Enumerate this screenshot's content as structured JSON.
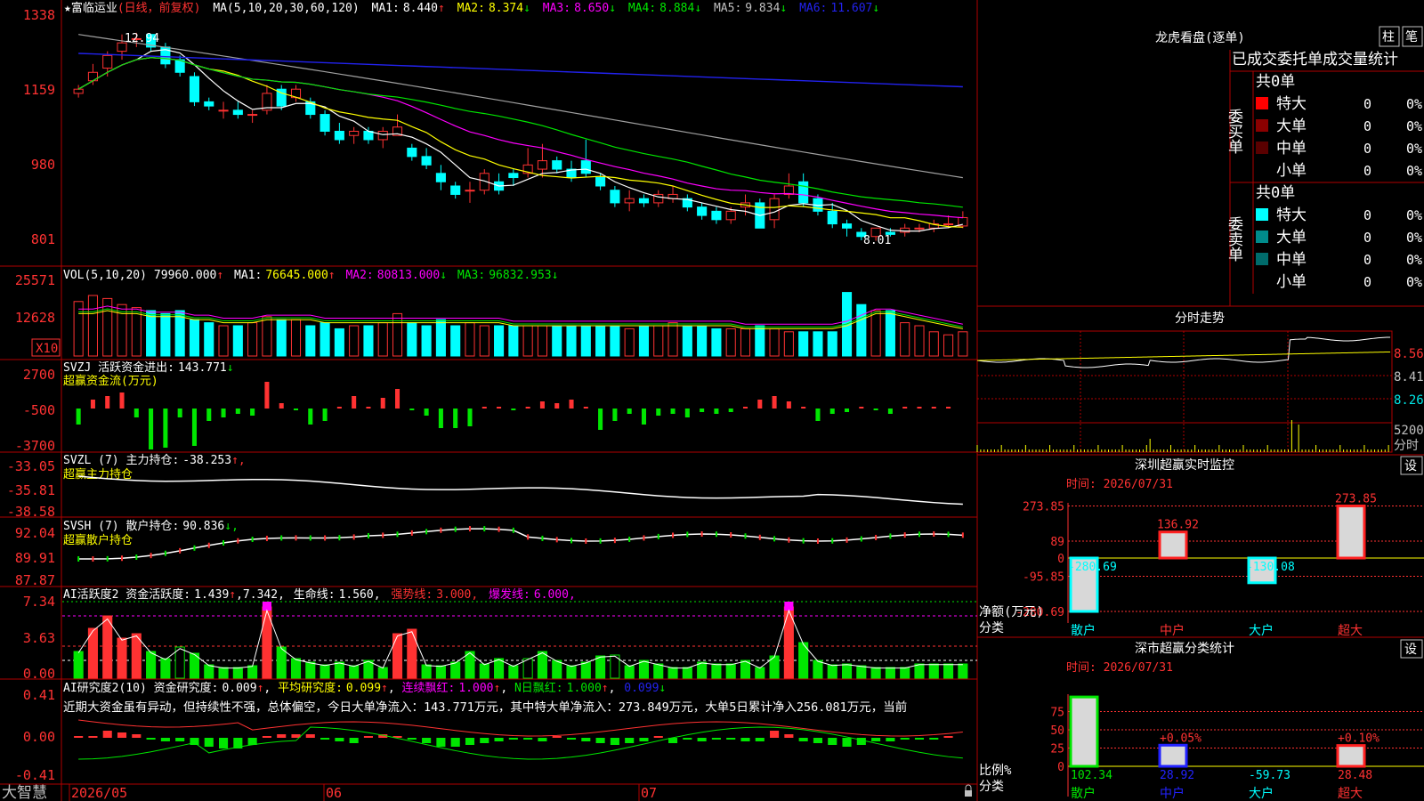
{
  "colors": {
    "background": "#000000",
    "frame": "#b00000",
    "up": "#ff3232",
    "down": "#00ffff",
    "ma1": "#ffffff",
    "ma2": "#ffff00",
    "ma3": "#ff00ff",
    "ma4": "#00e600",
    "ma5": "#a0a0a0",
    "ma6": "#2222ee",
    "green_bar": "#00e600",
    "axis_text": "#ff3232"
  },
  "main_panel": {
    "star": "★",
    "stock_name": "富临运业",
    "period_note": "(日线，前复权)",
    "ma_prefix": "MA(5,10,20,30,60,120)",
    "ma": [
      {
        "label": "MA1:",
        "value": "8.440",
        "arrow": "↑"
      },
      {
        "label": "MA2:",
        "value": "8.374",
        "arrow": "↓"
      },
      {
        "label": "MA3:",
        "value": "8.650",
        "arrow": "↓"
      },
      {
        "label": "MA4:",
        "value": "8.884",
        "arrow": "↓"
      },
      {
        "label": "MA5:",
        "value": "9.834",
        "arrow": "↓"
      },
      {
        "label": "MA6:",
        "value": "11.607",
        "arrow": "↓"
      }
    ],
    "y_ticks": [
      "1338",
      "1159",
      "980",
      "801"
    ],
    "high_label": "12.94",
    "low_label": "8.01"
  },
  "vol_panel": {
    "prefix": "VOL(5,10,20)",
    "value": "79960.000",
    "arrow": "↑",
    "ma": [
      {
        "label": "MA1:",
        "value": "76645.000",
        "arrow": "↑"
      },
      {
        "label": "MA2:",
        "value": "80813.000",
        "arrow": "↓"
      },
      {
        "label": "MA3:",
        "value": "96832.953",
        "arrow": "↓"
      }
    ],
    "y_ticks": [
      "25571",
      "12628"
    ],
    "unit": "X10"
  },
  "svzj_panel": {
    "title": "SVZJ  活跃资金进出:",
    "value": "143.771",
    "arrow": "↓",
    "subtitle": "超赢资金流(万元)",
    "y_ticks": [
      "2700",
      "-500",
      "-3700"
    ]
  },
  "svzl_panel": {
    "title": "SVZL (7) 主力持仓:",
    "value": "-38.253",
    "arrow": "↑,",
    "subtitle": "超赢主力持仓",
    "y_ticks": [
      "-33.05",
      "-35.81",
      "-38.58"
    ]
  },
  "svsh_panel": {
    "title": "SVSH (7) 散户持仓:",
    "value": "90.836",
    "arrow": "↓,",
    "subtitle": "超赢散户持仓",
    "y_ticks": [
      "92.04",
      "89.91",
      "87.87"
    ]
  },
  "ai_active_panel": {
    "title": "AI活跃度2 资金活跃度:",
    "v1": "1.439",
    "a1": "↑",
    "v2": ",7.342,",
    "life_label": "生命线:",
    "life_value": "1.560,",
    "strong_label": "强势线:",
    "strong_value": "3.000,",
    "burst_label": "爆发线:",
    "burst_value": "6.000,",
    "y_ticks": [
      "7.34",
      "3.63",
      "0.00"
    ]
  },
  "ai_research_panel": {
    "title": "AI研究度2(10) 资金研究度:",
    "v1": "0.009",
    "a1": "↑",
    "avg_label": "平均研究度:",
    "avg_value": "0.099",
    "avg_arrow": "↑",
    "red_label": "连续飘红:",
    "red_value": "1.000",
    "red_arrow": "↑",
    "nday_label": "N日飘红:",
    "nday_value": "1.000",
    "nday_arrow": "↑",
    "last_value": "0.099",
    "last_arrow": "↓",
    "commentary": "近期大资金虽有异动，但持续性不强，总体偏空，今日大单净流入：143.771万元，其中特大单净流入：273.849万元，大单5日累计净入256.081万元，当前",
    "y_ticks": [
      "0.41",
      "0.00",
      "-0.41"
    ]
  },
  "bottom_bar": {
    "brand": "大智慧",
    "dates": [
      "2026/05",
      "06",
      "07"
    ]
  },
  "right_panel": {
    "lhkp_title": "龙虎看盘(逐单)",
    "btn_zhu": "柱",
    "btn_bi": "笔",
    "stats_header": "已成交委托单成交量统计",
    "buy_label": "委买单",
    "sell_label": "委卖单",
    "buy_total": "共0单",
    "sell_total": "共0单",
    "buy_rows": [
      {
        "name": "特大",
        "count": "0",
        "pct": "0%",
        "color": "#ff0000"
      },
      {
        "name": "大单",
        "count": "0",
        "pct": "0%",
        "color": "#8b0000"
      },
      {
        "name": "中单",
        "count": "0",
        "pct": "0%",
        "color": "#5a0000"
      },
      {
        "name": "小单",
        "count": "0",
        "pct": "0%",
        "color": "#000000"
      }
    ],
    "sell_rows": [
      {
        "name": "特大",
        "count": "0",
        "pct": "0%",
        "color": "#00ffff"
      },
      {
        "name": "大单",
        "count": "0",
        "pct": "0%",
        "color": "#008b8b"
      },
      {
        "name": "中单",
        "count": "0",
        "pct": "0%",
        "color": "#006b6b"
      },
      {
        "name": "小单",
        "count": "0",
        "pct": "0%",
        "color": "#000000"
      }
    ],
    "intraday_title": "分时走势",
    "intraday_ticks": [
      "8.56",
      "8.41",
      "8.26"
    ],
    "intraday_vol_label": "5200",
    "intraday_vol_unit": "分时",
    "monitor_title": "深圳超赢实时监控",
    "monitor_settings": "设",
    "monitor_time": "时间: 2026/07/31",
    "monitor_y_ticks": [
      "273.85",
      "89",
      "0",
      "-95.85",
      "-280.69"
    ],
    "monitor_bars": [
      {
        "label": "散户",
        "value": "-280.69",
        "v": -280.69
      },
      {
        "label": "中户",
        "value": "136.92",
        "v": 136.92
      },
      {
        "label": "大户",
        "value": "-130.08",
        "v": -130.08
      },
      {
        "label": "超大",
        "value": "273.85",
        "v": 273.85
      }
    ],
    "monitor_axis_label1": "净额(万元)",
    "monitor_axis_label2": "分类",
    "class_title": "深市超赢分类统计",
    "class_settings": "设",
    "class_time": "时间: 2026/07/31",
    "class_y_ticks": [
      "75",
      "50",
      "25",
      "0"
    ],
    "class_axis_label1": "比例%",
    "class_axis_label2": "分类",
    "class_bars": [
      {
        "label": "散户",
        "value": "102.34",
        "pct": "",
        "v": 102.34,
        "color": "#00e600"
      },
      {
        "label": "中户",
        "value": "28.92",
        "pct": "+0.05%",
        "v": 28.92,
        "color": "#2222ff"
      },
      {
        "label": "大户",
        "value": "-59.73",
        "pct": "",
        "v": -59.73,
        "color": "#00ffff"
      },
      {
        "label": "超大",
        "value": "28.48",
        "pct": "+0.10%",
        "v": 28.48,
        "color": "#ff2020"
      }
    ]
  },
  "chart_data": {
    "type": "candlestick",
    "title": "富临运业 (日线，前复权)",
    "ylim": [
      8.01,
      13.38
    ],
    "candles": [
      [
        11.5,
        11.7,
        11.4,
        11.6
      ],
      [
        11.8,
        12.2,
        11.7,
        12.0
      ],
      [
        12.1,
        12.5,
        11.9,
        12.4
      ],
      [
        12.5,
        12.9,
        12.3,
        12.7
      ],
      [
        12.8,
        12.94,
        12.6,
        12.8
      ],
      [
        12.9,
        12.9,
        12.5,
        12.6
      ],
      [
        12.6,
        12.7,
        12.1,
        12.2
      ],
      [
        12.3,
        12.4,
        11.9,
        12.0
      ],
      [
        11.9,
        12.0,
        11.2,
        11.3
      ],
      [
        11.3,
        11.4,
        11.1,
        11.2
      ],
      [
        11.1,
        11.3,
        10.9,
        11.1
      ],
      [
        11.1,
        11.3,
        10.9,
        11.0
      ],
      [
        11.0,
        11.1,
        10.8,
        11.0
      ],
      [
        11.1,
        11.7,
        11.0,
        11.5
      ],
      [
        11.6,
        11.7,
        11.1,
        11.2
      ],
      [
        11.4,
        11.7,
        11.3,
        11.6
      ],
      [
        11.3,
        11.4,
        10.9,
        11.0
      ],
      [
        11.0,
        11.1,
        10.5,
        10.6
      ],
      [
        10.6,
        10.8,
        10.3,
        10.4
      ],
      [
        10.5,
        10.7,
        10.3,
        10.6
      ],
      [
        10.6,
        10.7,
        10.3,
        10.4
      ],
      [
        10.4,
        10.7,
        10.2,
        10.6
      ],
      [
        10.5,
        11.0,
        10.5,
        10.7
      ],
      [
        10.2,
        10.3,
        9.9,
        10.0
      ],
      [
        10.0,
        10.2,
        9.7,
        9.8
      ],
      [
        9.6,
        9.8,
        9.2,
        9.4
      ],
      [
        9.3,
        9.4,
        9.0,
        9.1
      ],
      [
        9.2,
        9.4,
        8.9,
        9.2
      ],
      [
        9.2,
        9.7,
        9.1,
        9.6
      ],
      [
        9.4,
        9.6,
        9.1,
        9.2
      ],
      [
        9.6,
        9.7,
        9.3,
        9.5
      ],
      [
        9.6,
        10.2,
        9.5,
        9.8
      ],
      [
        9.7,
        10.3,
        9.5,
        9.9
      ],
      [
        9.9,
        10.0,
        9.6,
        9.7
      ],
      [
        9.7,
        9.9,
        9.4,
        9.5
      ],
      [
        9.9,
        10.4,
        9.5,
        9.6
      ],
      [
        9.5,
        9.6,
        9.2,
        9.3
      ],
      [
        9.2,
        9.3,
        8.8,
        8.9
      ],
      [
        8.9,
        9.2,
        8.7,
        9.0
      ],
      [
        9.0,
        9.1,
        8.8,
        8.9
      ],
      [
        8.9,
        9.2,
        8.8,
        9.1
      ],
      [
        9.0,
        9.3,
        8.9,
        9.1
      ],
      [
        9.0,
        9.1,
        8.7,
        8.8
      ],
      [
        8.8,
        8.9,
        8.5,
        8.6
      ],
      [
        8.7,
        8.8,
        8.4,
        8.5
      ],
      [
        8.5,
        8.8,
        8.4,
        8.7
      ],
      [
        8.8,
        9.1,
        8.6,
        8.9
      ],
      [
        8.9,
        9.0,
        8.3,
        8.3
      ],
      [
        8.5,
        9.1,
        8.3,
        9.0
      ],
      [
        9.1,
        9.6,
        9.0,
        9.3
      ],
      [
        9.4,
        9.6,
        8.8,
        8.9
      ],
      [
        9.0,
        9.1,
        8.6,
        8.7
      ],
      [
        8.7,
        8.9,
        8.3,
        8.4
      ],
      [
        8.4,
        8.5,
        8.1,
        8.3
      ],
      [
        8.2,
        8.3,
        8.01,
        8.1
      ],
      [
        8.1,
        8.3,
        8.0,
        8.3
      ],
      [
        8.2,
        8.3,
        8.1,
        8.15
      ],
      [
        8.2,
        8.4,
        8.1,
        8.3
      ],
      [
        8.3,
        8.4,
        8.2,
        8.3
      ],
      [
        8.3,
        8.5,
        8.2,
        8.4
      ],
      [
        8.4,
        8.6,
        8.3,
        8.4
      ],
      [
        8.35,
        8.7,
        8.3,
        8.55
      ]
    ],
    "volume": [
      18,
      20,
      19,
      17,
      16,
      15,
      14,
      15,
      12,
      11,
      10,
      10,
      11,
      13,
      12,
      12,
      10,
      11,
      9,
      10,
      10,
      11,
      14,
      11,
      10,
      12,
      10,
      11,
      10,
      10,
      10,
      10,
      10,
      10,
      10,
      10,
      10,
      10,
      9,
      10,
      10,
      11,
      10,
      10,
      9,
      9,
      9,
      10,
      9,
      8,
      8,
      8,
      8,
      21,
      17,
      15,
      15,
      11,
      10,
      8,
      7,
      8,
      7,
      8,
      8,
      8
    ],
    "vol_ma": [
      14,
      14,
      15,
      14,
      14,
      13,
      13,
      13,
      12,
      12,
      11,
      11,
      11,
      12,
      12,
      12,
      12,
      11,
      11,
      11,
      11,
      11,
      11,
      11,
      11,
      11,
      11,
      11,
      11,
      11,
      10,
      10,
      10,
      10,
      10,
      10,
      10,
      10,
      10,
      10,
      10,
      10,
      10,
      10,
      10,
      10,
      9,
      9,
      9,
      9,
      9,
      9,
      9,
      10,
      12,
      14,
      14,
      13,
      12,
      11,
      10,
      9,
      9,
      8,
      8,
      8
    ]
  }
}
